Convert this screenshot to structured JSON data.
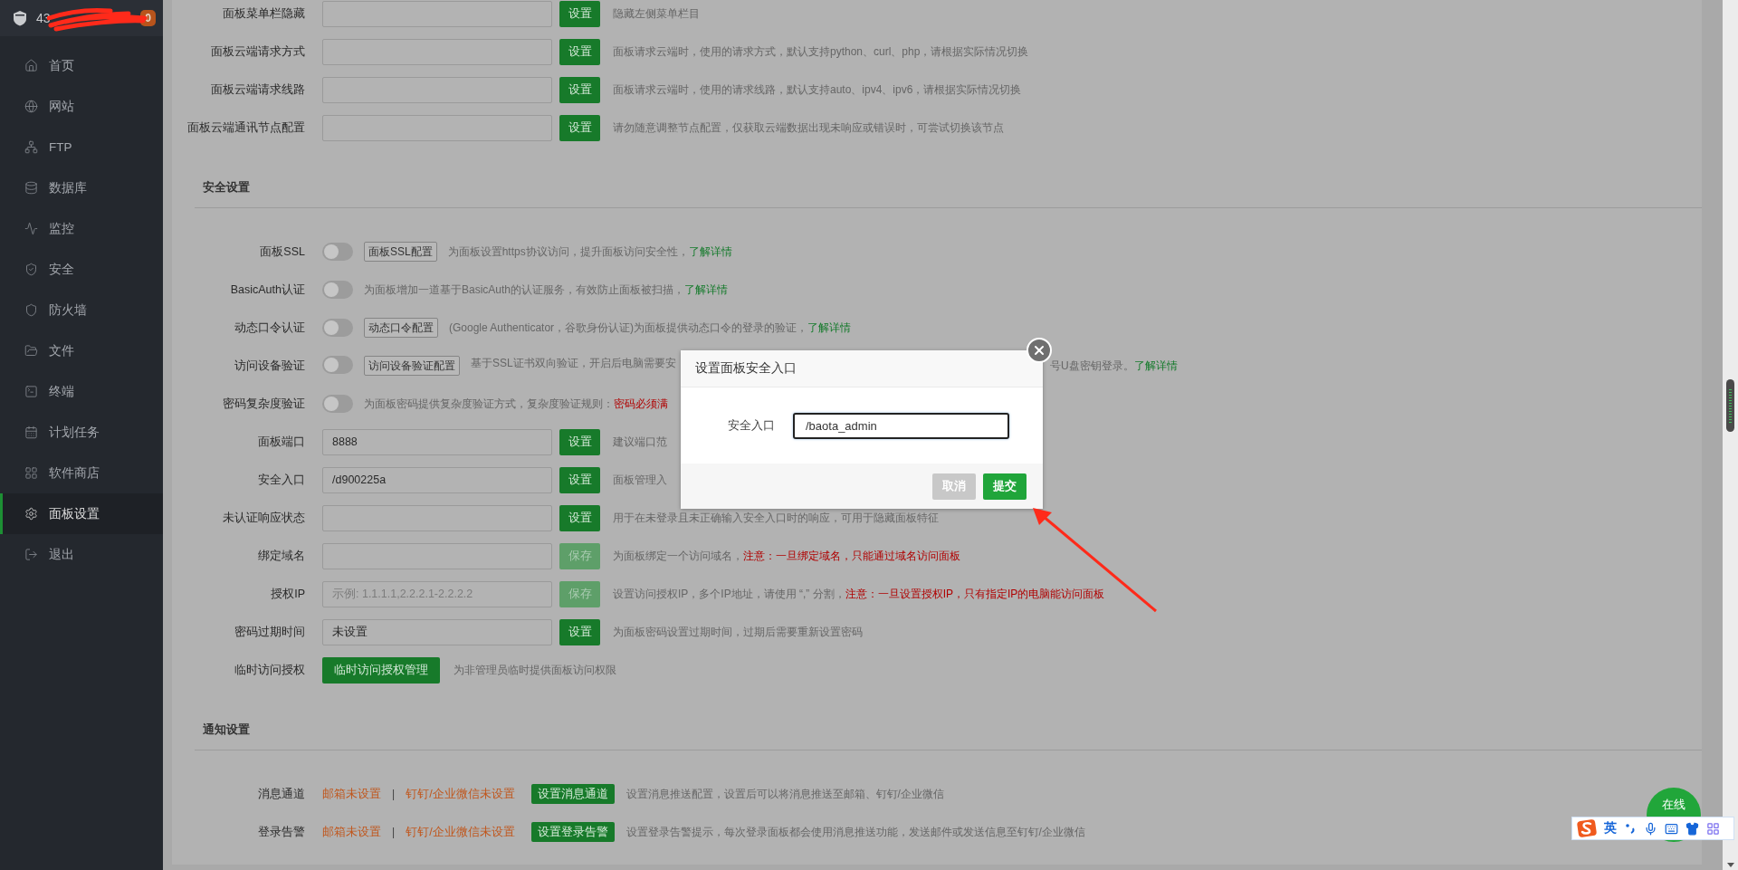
{
  "sidebar": {
    "header": {
      "title": "43",
      "badge": "0"
    },
    "items": [
      {
        "label": "首页",
        "selected": false
      },
      {
        "label": "网站",
        "selected": false
      },
      {
        "label": "FTP",
        "selected": false
      },
      {
        "label": "数据库",
        "selected": false
      },
      {
        "label": "监控",
        "selected": false
      },
      {
        "label": "安全",
        "selected": false
      },
      {
        "label": "防火墙",
        "selected": false
      },
      {
        "label": "文件",
        "selected": false
      },
      {
        "label": "终端",
        "selected": false
      },
      {
        "label": "计划任务",
        "selected": false
      },
      {
        "label": "软件商店",
        "selected": false
      },
      {
        "label": "面板设置",
        "selected": true
      },
      {
        "label": "退出",
        "selected": false
      }
    ]
  },
  "top_rows": [
    {
      "kind": "input",
      "label": "面板菜单栏隐藏",
      "button": {
        "label": "设置",
        "disabled": false
      },
      "description": [
        {
          "kind": "text",
          "text": "隐藏左侧菜单栏目"
        }
      ]
    },
    {
      "kind": "input",
      "label": "面板云端请求方式",
      "button": {
        "label": "设置",
        "disabled": false
      },
      "description": [
        {
          "kind": "text",
          "text": "面板请求云端时，使用的请求方式，默认支持python、curl、php，请根据实际情况切换"
        }
      ]
    },
    {
      "kind": "input",
      "label": "面板云端请求线路",
      "button": {
        "label": "设置",
        "disabled": false
      },
      "description": [
        {
          "kind": "text",
          "text": "面板请求云端时，使用的请求线路，默认支持auto、ipv4、ipv6，请根据实际情况切换"
        }
      ]
    },
    {
      "kind": "input",
      "label": "面板云端通讯节点配置",
      "button": {
        "label": "设置",
        "disabled": false
      },
      "description": [
        {
          "kind": "text",
          "text": "请勿随意调整节点配置，仅获取云端数据出现未响应或错误时，可尝试切换该节点"
        }
      ]
    }
  ],
  "security": {
    "title": "安全设置",
    "rows": [
      {
        "kind": "toggle",
        "label": "面板SSL",
        "on": false,
        "config_button": "面板SSL配置",
        "description": [
          {
            "kind": "text",
            "text": "为面板设置https协议访问，提升面板访问安全性，"
          },
          {
            "kind": "link",
            "text": "了解详情"
          }
        ]
      },
      {
        "kind": "toggle",
        "label": "BasicAuth认证",
        "on": false,
        "description": [
          {
            "kind": "text",
            "text": "为面板增加一道基于BasicAuth的认证服务，有效防止面板被扫描，"
          },
          {
            "kind": "link",
            "text": "了解详情"
          }
        ]
      },
      {
        "kind": "toggle",
        "label": "动态口令认证",
        "on": false,
        "config_button": "动态口令配置",
        "description": [
          {
            "kind": "text",
            "text": "(Google Authenticator，谷歌身份认证)为面板提供动态口令的登录的验证，"
          },
          {
            "kind": "link",
            "text": "了解详情"
          }
        ]
      },
      {
        "kind": "toggle",
        "label": "访问设备验证",
        "on": false,
        "config_button": "访问设备验证配置",
        "description": [
          {
            "kind": "text",
            "text": "基于SSL证书双向验证，开启后电脑需要安"
          }
        ],
        "description_after": [
          {
            "kind": "text",
            "text": "号U盘密钥登录。"
          },
          {
            "kind": "link",
            "text": "了解详情"
          }
        ]
      },
      {
        "kind": "toggle",
        "label": "密码复杂度验证",
        "on": false,
        "description": [
          {
            "kind": "text",
            "text": "为面板密码提供复杂度验证方式，复杂度验证规则："
          },
          {
            "kind": "warning",
            "text": "密码必须满"
          }
        ]
      },
      {
        "kind": "input",
        "label": "面板端口",
        "value": "8888",
        "button": {
          "label": "设置",
          "disabled": false
        },
        "description": [
          {
            "kind": "text",
            "text": "建议端口范"
          }
        ]
      },
      {
        "kind": "input",
        "label": "安全入口",
        "value": "/d900225a",
        "button": {
          "label": "设置",
          "disabled": false
        },
        "description": [
          {
            "kind": "text",
            "text": "面板管理入"
          }
        ]
      },
      {
        "kind": "input",
        "label": "未认证响应状态",
        "button": {
          "label": "设置",
          "disabled": false
        },
        "description": [
          {
            "kind": "text",
            "text": "用于在未登录且未正确输入安全入口时的响应，可用于隐藏面板特征"
          }
        ]
      },
      {
        "kind": "input",
        "label": "绑定域名",
        "button": {
          "label": "保存",
          "disabled": true
        },
        "description": [
          {
            "kind": "text",
            "text": "为面板绑定一个访问域名，"
          },
          {
            "kind": "warning",
            "text": "注意：一旦绑定域名，只能通过域名访问面板"
          }
        ]
      },
      {
        "kind": "input",
        "label": "授权IP",
        "placeholder": "示例: 1.1.1.1,2.2.2.1-2.2.2.2",
        "button": {
          "label": "保存",
          "disabled": true
        },
        "description": [
          {
            "kind": "text",
            "text": "设置访问授权IP，多个IP地址，请使用 “,” 分割，"
          },
          {
            "kind": "warning",
            "text": "注意：一旦设置授权IP，只有指定IP的电脑能访问面板"
          }
        ]
      },
      {
        "kind": "input",
        "label": "密码过期时间",
        "value": "未设置",
        "button": {
          "label": "设置",
          "disabled": false
        },
        "description": [
          {
            "kind": "text",
            "text": "为面板密码设置过期时间，过期后需要重新设置密码"
          }
        ]
      },
      {
        "kind": "action",
        "label": "临时访问授权",
        "button": {
          "label": "临时访问授权管理"
        },
        "description": [
          {
            "kind": "text",
            "text": "为非管理员临时提供面板访问权限"
          }
        ]
      }
    ]
  },
  "notifications": {
    "title": "通知设置",
    "rows": [
      {
        "kind": "channel",
        "label": "消息通道",
        "email_status": "邮箱未设置",
        "separator": "|",
        "im_status": "钉钉/企业微信未设置",
        "button": {
          "label": "设置消息通道"
        },
        "description": [
          {
            "kind": "text",
            "text": "设置消息推送配置，设置后可以将消息推送至邮箱、钉钉/企业微信"
          }
        ]
      },
      {
        "kind": "channel",
        "label": "登录告警",
        "email_status": "邮箱未设置",
        "separator": "|",
        "im_status": "钉钉/企业微信未设置",
        "button": {
          "label": "设置登录告警"
        },
        "description": [
          {
            "kind": "text",
            "text": "设置登录告警提示，每次登录面板都会使用消息推送功能，发送邮件或发送信息至钉钉/企业微信"
          }
        ]
      }
    ]
  },
  "dialog": {
    "title": "设置面板安全入口",
    "field": {
      "label": "安全入口",
      "value": "/baota_admin"
    },
    "buttons": [
      {
        "kind": "cancel",
        "label": "取消"
      },
      {
        "kind": "submit",
        "label": "提交"
      }
    ]
  },
  "online_button": {
    "label": "在线"
  },
  "ime_bar": {
    "mode": "英"
  }
}
